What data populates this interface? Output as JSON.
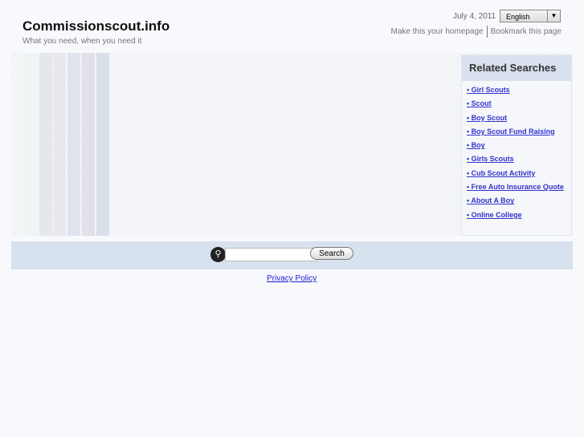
{
  "header": {
    "title": "Commissionscout.info",
    "tagline": "What you need, when you need it",
    "date": "July 4, 2011",
    "language": "English",
    "homepage_link": "Make this your homepage",
    "bookmark_link": "Bookmark this page"
  },
  "sidebar": {
    "title": "Related Searches",
    "items": [
      "• Girl Scouts",
      "• Scout",
      "• Boy Scout",
      "• Boy Scout Fund Raising",
      "• Boy",
      "• Girls Scouts",
      "• Cub Scout Activity",
      "• Free Auto Insurance Quote",
      "• About A Boy",
      "• Online College"
    ]
  },
  "search": {
    "button": "Search",
    "value": ""
  },
  "footer": {
    "privacy": "Privacy Policy"
  }
}
